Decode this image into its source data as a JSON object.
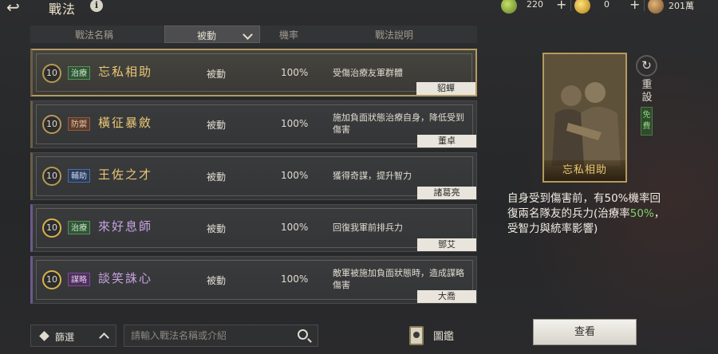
{
  "title": "戰法",
  "currencies": [
    {
      "value": "220",
      "color": "#8fb23a"
    },
    {
      "value": "0",
      "color": "#d9a42a"
    },
    {
      "value": "201萬",
      "color": "#b8874e"
    }
  ],
  "header": {
    "col_name": "戰法名稱",
    "filter_value": "被動",
    "col_rate": "機率",
    "col_desc": "戰法說明"
  },
  "skills": [
    {
      "level": "10",
      "tag": "治療",
      "name": "忘私相助",
      "type": "被動",
      "rate": "100%",
      "desc": "受傷治療友軍群體",
      "general": "貂蟬"
    },
    {
      "level": "10",
      "tag": "防禦",
      "name": "橫征暴斂",
      "type": "被動",
      "rate": "100%",
      "desc": "施加負面狀態治療自身，降低受到傷害",
      "general": "董卓"
    },
    {
      "level": "10",
      "tag": "輔助",
      "name": "王佐之才",
      "type": "被動",
      "rate": "100%",
      "desc": "獲得奇謀，提升智力",
      "general": "諸葛亮"
    },
    {
      "level": "10",
      "tag": "治療",
      "name": "來好息師",
      "type": "被動",
      "rate": "100%",
      "desc": "回復我軍前排兵力",
      "general": "鄧艾"
    },
    {
      "level": "10",
      "tag": "謀略",
      "name": "談笑誅心",
      "type": "被動",
      "rate": "100%",
      "desc": "敵軍被施加負面狀態時，造成謀略傷害",
      "general": "大喬"
    }
  ],
  "bottom": {
    "filter_label": "篩選",
    "search_placeholder": "請輸入戰法名稱或介紹",
    "codex_label": "圖鑑"
  },
  "detail": {
    "card_name": "忘私相助",
    "reset_label": "重設",
    "free_label": "免費",
    "effect_pre": "自身受到傷害前，有50%機率回復兩名隊友的兵力(治療率",
    "effect_hl": "50%",
    "effect_post": "，受智力與統率影響)",
    "view_label": "查看"
  }
}
